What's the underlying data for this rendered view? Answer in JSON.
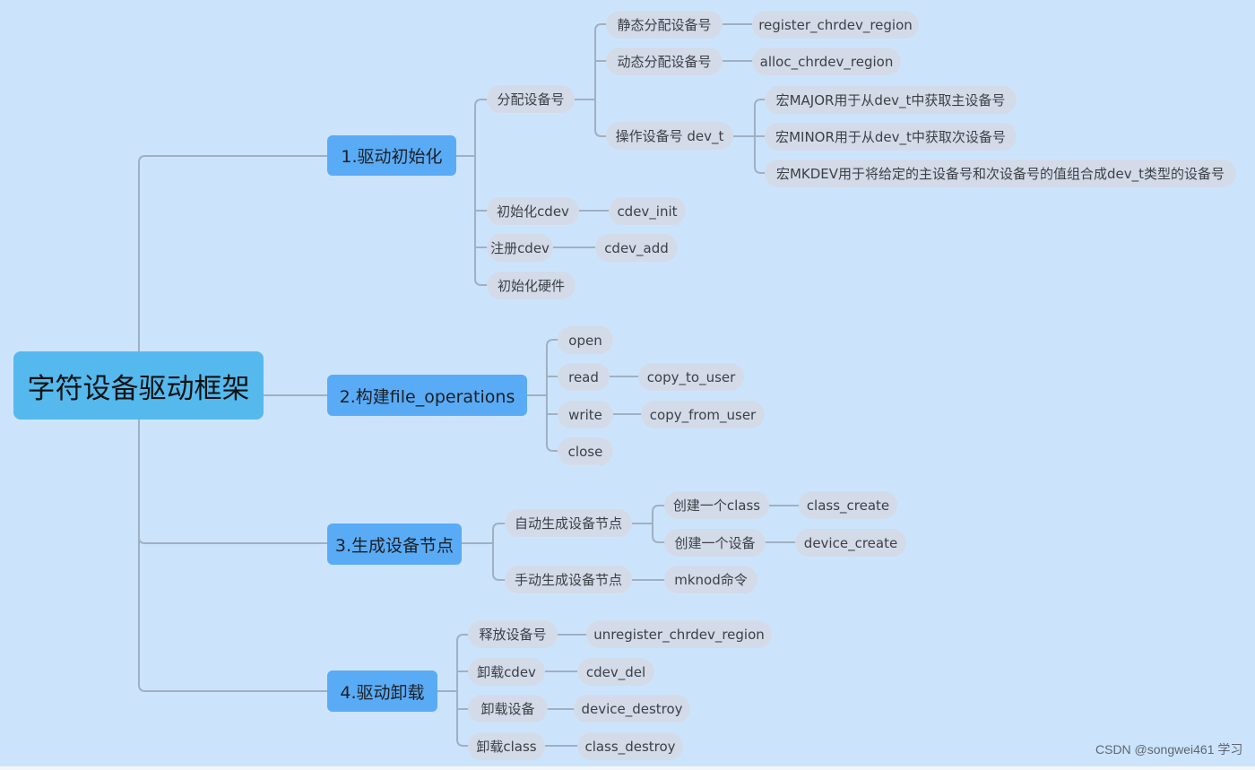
{
  "title": "字符设备驱动框架",
  "colors": {
    "background": "#cce4fb",
    "root_fill": "#55b9ee",
    "main_fill": "#5aabf6",
    "sub_fill": "#d3dbe8",
    "connector": "#9fb0c3"
  },
  "root": {
    "label": "字符设备驱动框架"
  },
  "branches": [
    {
      "label": "1.驱动初始化",
      "children": [
        {
          "label": "分配设备号",
          "children": [
            {
              "label": "静态分配设备号",
              "children": [
                {
                  "label": "register_chrdev_region"
                }
              ]
            },
            {
              "label": "动态分配设备号",
              "children": [
                {
                  "label": "alloc_chrdev_region"
                }
              ]
            },
            {
              "label": "操作设备号 dev_t",
              "children": [
                {
                  "label": "宏MAJOR用于从dev_t中获取主设备号"
                },
                {
                  "label": "宏MINOR用于从dev_t中获取次设备号"
                },
                {
                  "label": "宏MKDEV用于将给定的主设备号和次设备号的值组合成dev_t类型的设备号"
                }
              ]
            }
          ]
        },
        {
          "label": "初始化cdev",
          "children": [
            {
              "label": "cdev_init"
            }
          ]
        },
        {
          "label": "注册cdev",
          "children": [
            {
              "label": "cdev_add"
            }
          ]
        },
        {
          "label": "初始化硬件"
        }
      ]
    },
    {
      "label": "2.构建file_operations",
      "children": [
        {
          "label": "open"
        },
        {
          "label": "read",
          "children": [
            {
              "label": "copy_to_user"
            }
          ]
        },
        {
          "label": "write",
          "children": [
            {
              "label": "copy_from_user"
            }
          ]
        },
        {
          "label": "close"
        }
      ]
    },
    {
      "label": "3.生成设备节点",
      "children": [
        {
          "label": "自动生成设备节点",
          "children": [
            {
              "label": "创建一个class",
              "children": [
                {
                  "label": "class_create"
                }
              ]
            },
            {
              "label": "创建一个设备",
              "children": [
                {
                  "label": "device_create"
                }
              ]
            }
          ]
        },
        {
          "label": "手动生成设备节点",
          "children": [
            {
              "label": "mknod命令"
            }
          ]
        }
      ]
    },
    {
      "label": "4.驱动卸载",
      "children": [
        {
          "label": "释放设备号",
          "children": [
            {
              "label": "unregister_chrdev_region"
            }
          ]
        },
        {
          "label": "卸载cdev",
          "children": [
            {
              "label": "cdev_del"
            }
          ]
        },
        {
          "label": "卸载设备",
          "children": [
            {
              "label": "device_destroy"
            }
          ]
        },
        {
          "label": "卸载class",
          "children": [
            {
              "label": "class_destroy"
            }
          ]
        }
      ]
    }
  ],
  "watermark": "CSDN @songwei461 学习"
}
